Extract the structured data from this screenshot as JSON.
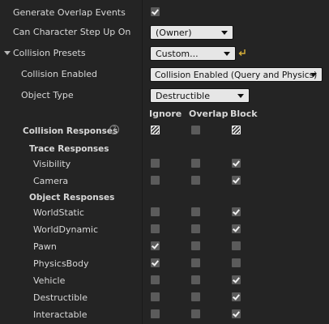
{
  "rows": {
    "generate_overlap": {
      "label": "Generate Overlap Events",
      "checked": true
    },
    "can_step_up": {
      "label": "Can Character Step Up On",
      "value": "(Owner)"
    },
    "collision_presets": {
      "label": "Collision Presets",
      "value": "Custom..."
    },
    "collision_enabled": {
      "label": "Collision Enabled",
      "value": "Collision Enabled (Query and Physics)"
    },
    "object_type": {
      "label": "Object Type",
      "value": "Destructible"
    }
  },
  "columns": {
    "ignore": "Ignore",
    "overlap": "Overlap",
    "block": "Block"
  },
  "collision_responses": {
    "label": "Collision Responses",
    "help": "?"
  },
  "trace_responses": {
    "label": "Trace Responses",
    "items": [
      {
        "label": "Visibility",
        "state": "block"
      },
      {
        "label": "Camera",
        "state": "block"
      }
    ]
  },
  "object_responses": {
    "label": "Object Responses",
    "items": [
      {
        "label": "WorldStatic",
        "state": "block"
      },
      {
        "label": "WorldDynamic",
        "state": "block"
      },
      {
        "label": "Pawn",
        "state": "ignore"
      },
      {
        "label": "PhysicsBody",
        "state": "ignore"
      },
      {
        "label": "Vehicle",
        "state": "block"
      },
      {
        "label": "Destructible",
        "state": "block"
      },
      {
        "label": "Interactable",
        "state": "block"
      }
    ]
  },
  "colors": {
    "background": "#242424",
    "checkbox": "#5b5b5b",
    "reset_arrow": "#d9b13a"
  }
}
